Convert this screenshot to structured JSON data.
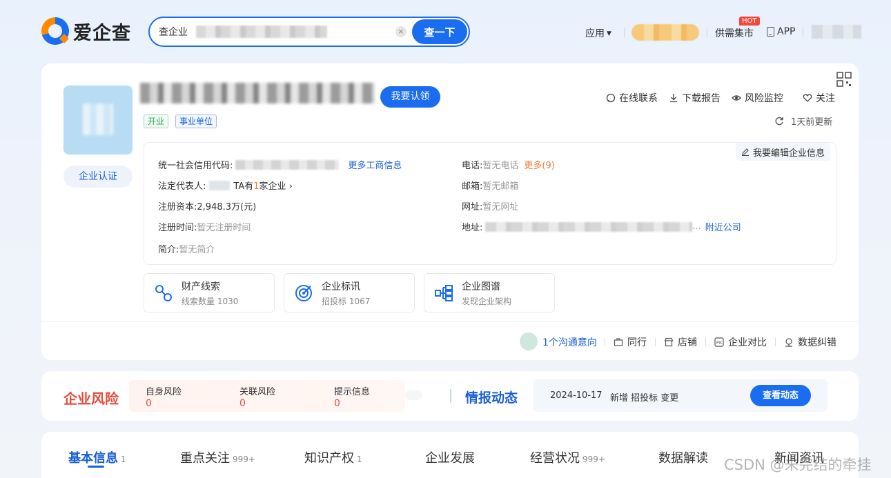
{
  "header": {
    "logo_text": "爱企查",
    "search": {
      "label": "查企业",
      "button": "查一下",
      "clear_icon": "close-icon"
    },
    "nav": {
      "app": "应用",
      "market": "供需集市",
      "hot_badge": "HOT",
      "app_download": "APP"
    }
  },
  "company": {
    "claim_button": "我要认领",
    "certify_button": "企业认证",
    "tags": [
      "开业",
      "事业单位"
    ],
    "actions": [
      "在线联系",
      "下载报告",
      "风险监控",
      "关注"
    ],
    "updated": "1天前更新",
    "edit_info": "我要编辑企业信息",
    "fields": {
      "credit_code_label": "统一社会信用代码:",
      "more_business_info": "更多工商信息",
      "legal_rep_label": "法定代表人:",
      "legal_rep_note_pre": "TA有",
      "legal_rep_count": "1",
      "legal_rep_note_post": "家企业 ›",
      "capital_label": "注册资本:",
      "capital_value": "2,948.3万(元)",
      "reg_time_label": "注册时间:",
      "reg_time_value": "暂无注册时间",
      "intro_label": "简介:",
      "intro_value": "暂无简介",
      "phone_label": "电话:",
      "phone_value": "暂无电话",
      "phone_more": "更多(9)",
      "email_label": "邮箱:",
      "email_value": "暂无邮箱",
      "website_label": "网址:",
      "website_value": "暂无网址",
      "address_label": "地址:",
      "address_ellipsis": "...",
      "nearby": "附近公司"
    },
    "features": [
      {
        "title": "财产线索",
        "sub": "线索数量 1030",
        "icon": "property-clue-icon"
      },
      {
        "title": "企业标讯",
        "sub": "招投标 1067",
        "icon": "bid-target-icon"
      },
      {
        "title": "企业图谱",
        "sub": "发现企业架构",
        "icon": "org-chart-icon"
      }
    ],
    "bottom_links": {
      "intent": "1个沟通意向",
      "peers": "同行",
      "shop": "店铺",
      "compare": "企业对比",
      "correct": "数据纠错"
    }
  },
  "risk": {
    "title": "企业风险",
    "items": [
      {
        "label": "自身风险",
        "value": "0"
      },
      {
        "label": "关联风险",
        "value": "0"
      },
      {
        "label": "提示信息",
        "value": "0"
      }
    ]
  },
  "intel": {
    "title": "情报动态",
    "date": "2024-10-17",
    "text": "新增 招投标 变更",
    "button": "查看动态"
  },
  "tabs": [
    {
      "label": "基本信息",
      "count": "1",
      "active": true
    },
    {
      "label": "重点关注",
      "count": "999+"
    },
    {
      "label": "知识产权",
      "count": "1"
    },
    {
      "label": "企业发展",
      "count": ""
    },
    {
      "label": "经营状况",
      "count": "999+"
    },
    {
      "label": "数据解读",
      "count": ""
    },
    {
      "label": "新闻资讯",
      "count": ""
    }
  ],
  "watermark": "CSDN @未完结的牵挂",
  "colors": {
    "primary": "#1a6cf0",
    "risk_red": "#e94a3a",
    "link_blue": "#1a5fd6",
    "orange": "#f5793a"
  }
}
